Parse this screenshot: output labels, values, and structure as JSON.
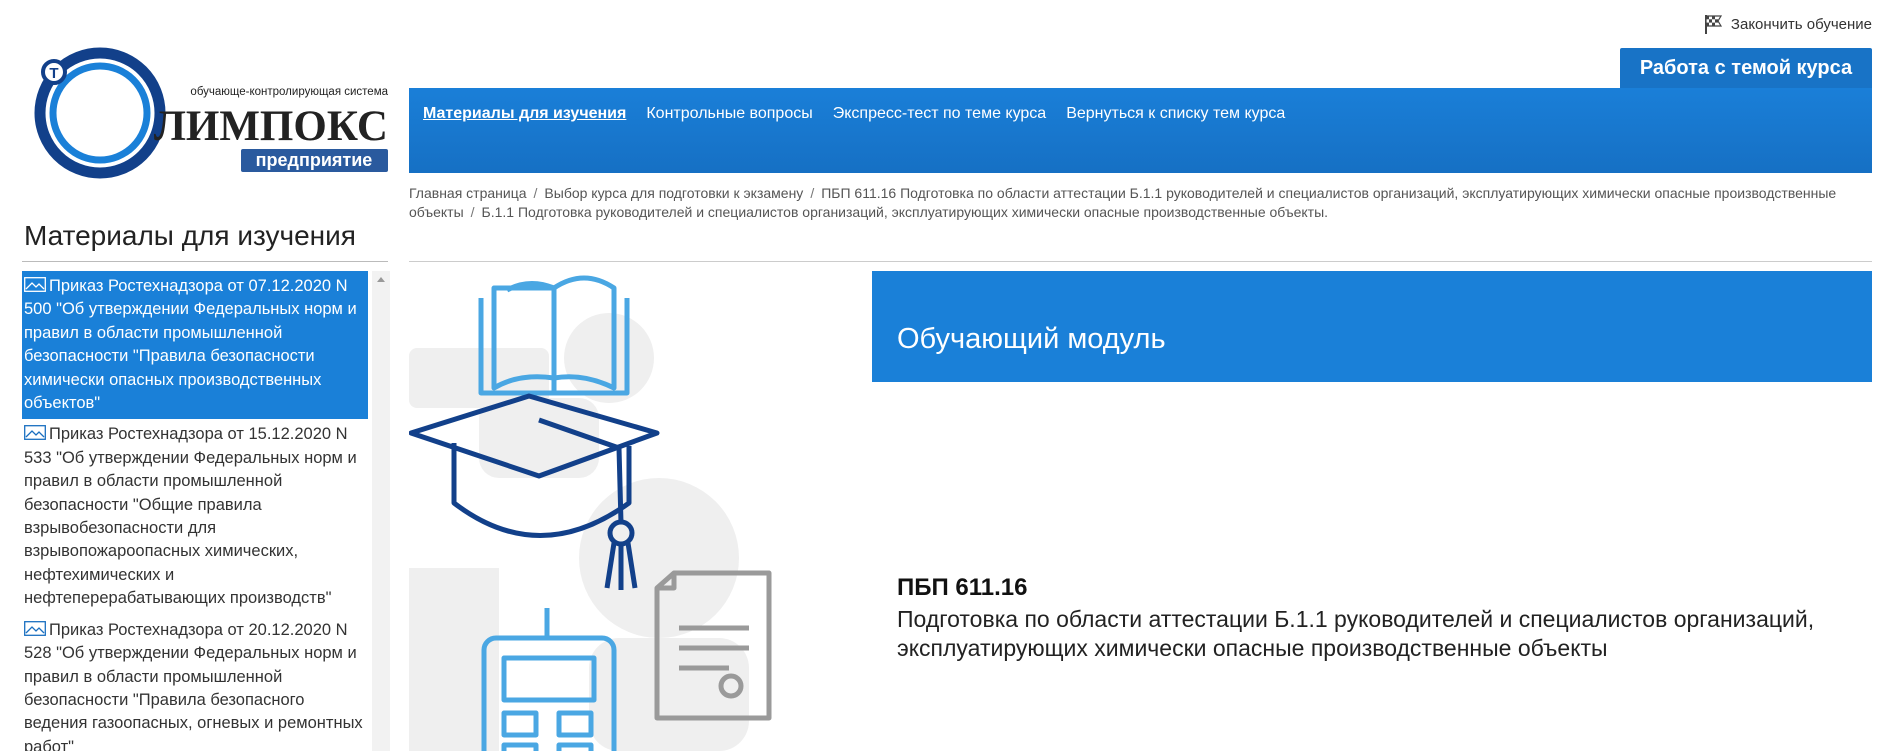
{
  "header": {
    "finish_label": "Закончить обучение",
    "logo": {
      "tagline": "обучающе-контролирующая система",
      "name": "ЛИМПОКС",
      "badge": "предприятие"
    }
  },
  "course_tab": {
    "label": "Работа с темой курса"
  },
  "nav": {
    "items": [
      {
        "label": "Материалы для изучения",
        "active": true
      },
      {
        "label": "Контрольные вопросы"
      },
      {
        "label": "Экспресс-тест по теме курса"
      },
      {
        "label": "Вернуться к списку тем курса"
      }
    ]
  },
  "breadcrumb": [
    "Главная страница",
    "Выбор курса для подготовки к экзамену",
    "ПБП 611.16 Подготовка по области аттестации Б.1.1 руководителей и специалистов организаций, эксплуатирующих химически опасные производственные объекты",
    "Б.1.1 Подготовка руководителей и специалистов организаций, эксплуатирующих химически опасные производственные объекты."
  ],
  "sidebar": {
    "title": "Материалы для изучения",
    "items": [
      {
        "text": "Приказ Ростехнадзора от 07.12.2020 N 500 \"Об утверждении Федеральных норм и правил в области промышленной безопасности \"Правила безопасности химически опасных производственных объектов\"",
        "selected": true
      },
      {
        "text": "Приказ Ростехнадзора от 15.12.2020 N 533 \"Об утверждении Федеральных норм и правил в области промышленной безопасности \"Общие правила взрывобезопасности для взрывопожароопасных химических, нефтехимических и нефтеперерабатывающих производств\""
      },
      {
        "text": "Приказ Ростехнадзора от 20.12.2020 N 528 \"Об утверждении Федеральных норм и правил в области промышленной безопасности \"Правила безопасного ведения газоопасных, огневых и ремонтных работ\""
      }
    ]
  },
  "module": {
    "banner_title": "Обучающий модуль",
    "code": "ПБП 611.16",
    "description": "Подготовка по области аттестации Б.1.1 руководителей и специалистов организаций, эксплуатирующих химически опасные производственные объекты"
  },
  "colors": {
    "primary_blue": "#1a80d8",
    "logo_navy": "#12408a",
    "illustration_blue": "#4aa7e3"
  }
}
